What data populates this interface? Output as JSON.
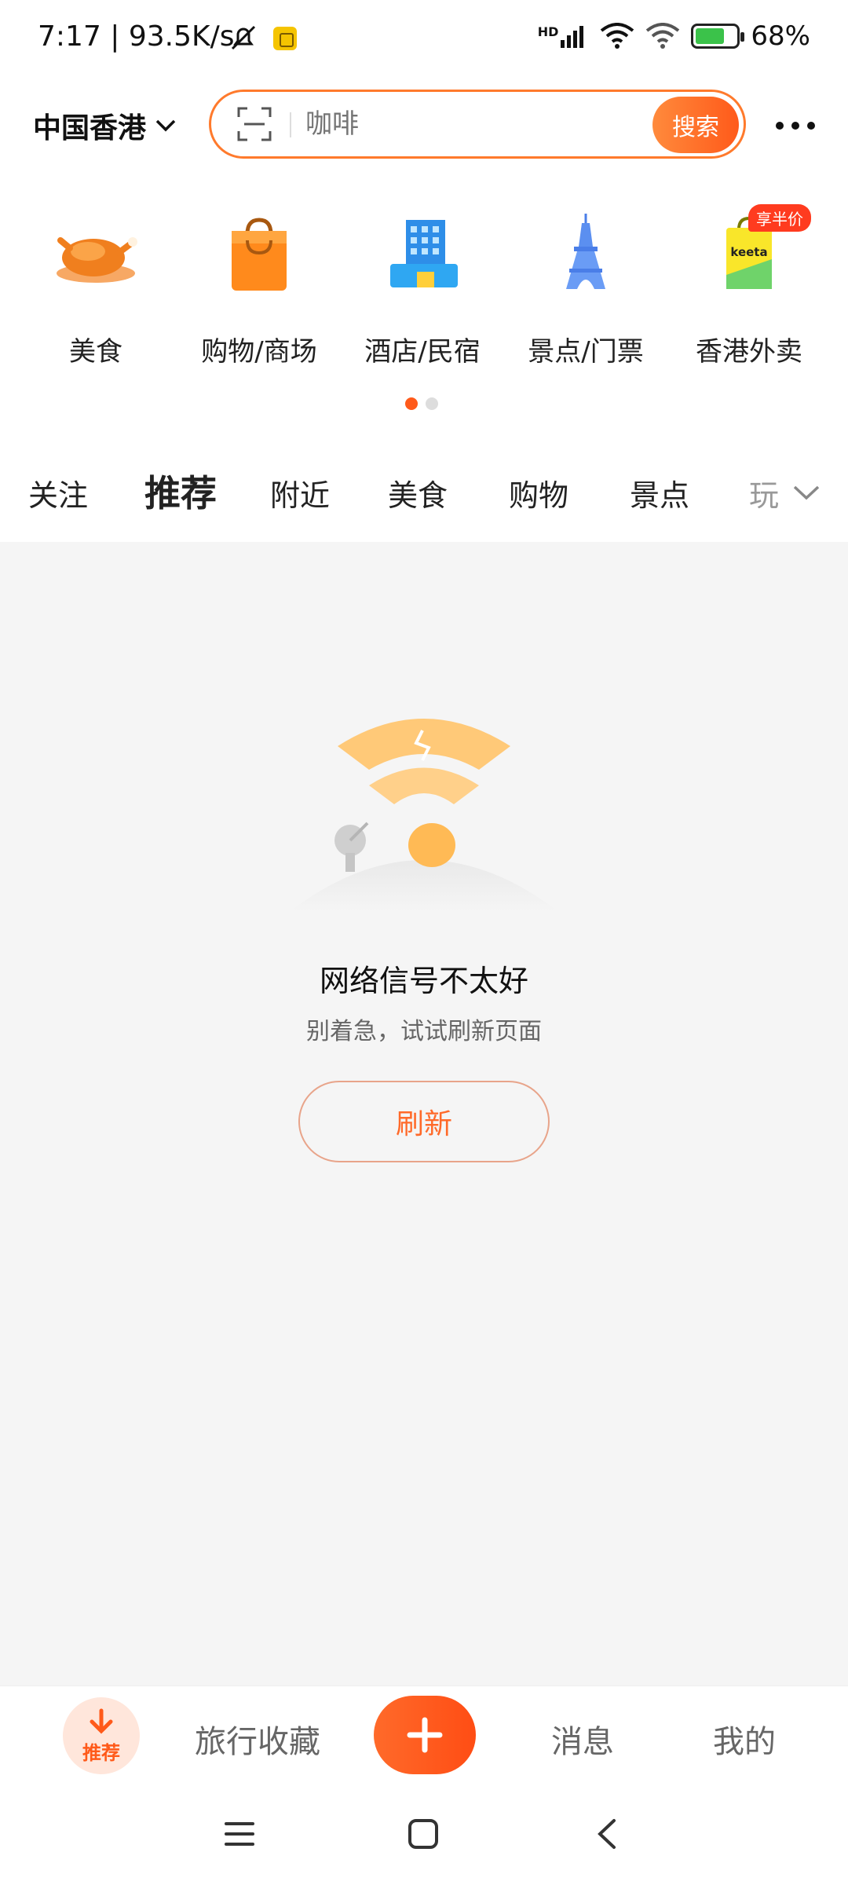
{
  "status_bar": {
    "time": "7:17 | 93.5K/s",
    "battery": "68%",
    "network_badge": "HD"
  },
  "header": {
    "city": "中国香港",
    "search_placeholder": "咖啡",
    "search_button": "搜索"
  },
  "categories": [
    {
      "label": "美食",
      "icon": "roast-chicken-icon"
    },
    {
      "label": "购物/商场",
      "icon": "shopping-bag-icon"
    },
    {
      "label": "酒店/民宿",
      "icon": "hotel-building-icon"
    },
    {
      "label": "景点/门票",
      "icon": "eiffel-tower-icon"
    },
    {
      "label": "香港外卖",
      "icon": "keeta-bag-icon",
      "badge": "享半价"
    }
  ],
  "carousel": {
    "pages": 2,
    "active": 1
  },
  "tabs": [
    "关注",
    "推荐",
    "附近",
    "美食",
    "购物",
    "景点",
    "玩"
  ],
  "active_tab": "推荐",
  "empty_state": {
    "title": "网络信号不太好",
    "subtitle": "别着急，试试刷新页面",
    "button": "刷新"
  },
  "bottom_nav": {
    "recommend": "推荐",
    "favorites": "旅行收藏",
    "messages": "消息",
    "mine": "我的"
  },
  "colors": {
    "accent": "#ff5a1a",
    "accent_light": "#ff8a3c",
    "background": "#f5f5f5"
  }
}
